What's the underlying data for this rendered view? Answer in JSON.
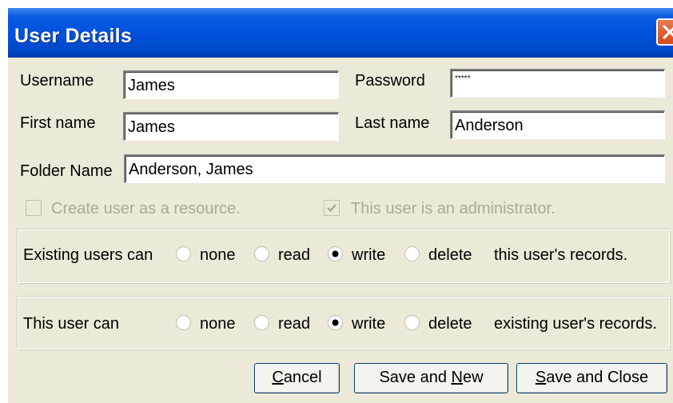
{
  "window": {
    "title": "User Details"
  },
  "form": {
    "username_label": "Username",
    "username_value": "James",
    "password_label": "Password",
    "password_value": "*****",
    "first_name_label": "First name",
    "first_name_value": "James",
    "last_name_label": "Last name",
    "last_name_value": "Anderson",
    "folder_name_label": "Folder Name",
    "folder_name_value": "Anderson, James",
    "resource_checkbox_label": "Create user as a resource.",
    "resource_checked": false,
    "admin_checkbox_label": "This user is an administrator.",
    "admin_checked": true
  },
  "existing_users_group": {
    "label": "Existing users can",
    "options": [
      "none",
      "read",
      "write",
      "delete"
    ],
    "selected": "write",
    "suffix": "this user's records."
  },
  "this_user_group": {
    "label": "This user can",
    "options": [
      "none",
      "read",
      "write",
      "delete"
    ],
    "selected": "write",
    "suffix": "existing user's records."
  },
  "buttons": {
    "cancel_prefix": "",
    "cancel_mnemonic": "C",
    "cancel_rest": "ancel",
    "save_new_prefix": "Save and ",
    "save_new_mnemonic": "N",
    "save_new_rest": "ew",
    "save_close_prefix": "",
    "save_close_mnemonic": "S",
    "save_close_rest": "ave and Close"
  },
  "colors": {
    "titlebar": "#0052DD",
    "dialog_bg": "#ECE9D8",
    "close_button": "#D5481E",
    "disabled_text": "#ACA899"
  }
}
